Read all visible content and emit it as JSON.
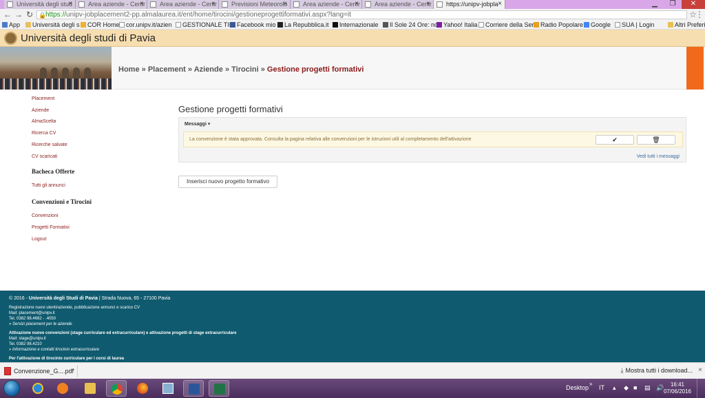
{
  "browser": {
    "tabs": [
      {
        "label": "Università degli stud"
      },
      {
        "label": "Area aziende - Centr"
      },
      {
        "label": "Area aziende - Centr"
      },
      {
        "label": "Previsioni Meteorolo"
      },
      {
        "label": "Area aziende - Centr"
      },
      {
        "label": "Area aziende - Centr"
      },
      {
        "label": "https://unipv-jobpla"
      }
    ],
    "url_scheme": "https://",
    "url_rest": "unipv-jobplacement2-pp.almalaurea.it/ent/home/tirocini/gestioneprogettiformativi.aspx?lang=it",
    "bookmarks": [
      "App",
      "Università degli s",
      "COR Home",
      "cor.unipv.it/azien",
      "GESTIONALE TIR",
      "Facebook mio",
      "La Repubblica.it",
      "Internazionale",
      "Il Sole 24 Ore: no",
      "Yahoo! Italia",
      "Corriere della Ser",
      "Radio Popolare",
      "Google",
      "SUA | Login",
      "Altri Preferiti"
    ]
  },
  "site": {
    "title": "Università degli studi di Pavia",
    "accent": "#8b1a1a",
    "orange": "#f16a1c"
  },
  "breadcrumb": {
    "home": "Home",
    "placement": "Placement",
    "aziende": "Aziende",
    "tirocini": "Tirocini",
    "current": "Gestione progetti formativi",
    "sep": "»"
  },
  "sidebar": {
    "links1": [
      "Placement",
      "Aziende",
      "AlmaScelta",
      "Ricerca CV",
      "Ricerche salvate",
      "CV scaricati"
    ],
    "heading_bacheca": "Bacheca Offerte",
    "links2": [
      "Tutti gli annunci"
    ],
    "heading_convenzioni": "Convenzioni e Tirocini",
    "links3": [
      "Convenzioni",
      "Progetti Formativi",
      "Logout"
    ]
  },
  "main": {
    "title": "Gestione progetti formativi",
    "messages_label": "Messaggi",
    "alert_text": "La convenzione è stata approvata. Consulta la pagina relativa alle convenzioni per le istruzioni utili al completamento dell'attivazione",
    "check_icon": "✔",
    "trash_icon": "🗑",
    "see_all": "Vedi tutti i messaggi",
    "new_button": "Inserisci nuovo progetto formativo"
  },
  "footer": {
    "copyright": "© 2016 - ",
    "uni": "Università degli Studi di Pavia",
    "address": " | Strada Nuova, 65 - 27100 Pavia",
    "b1_title": "Registrazione nuovi utenti/aziende, pubblicazione annunci e scarico CV",
    "b1_mail": "Mail: placement@unipv.it",
    "b1_tel": "Tel. 0382 98.4692 - .4050",
    "b1_link": "» Servizi placement per le aziende",
    "b2_title": "Attivazione nuove convenzioni (stage curriculare ed extracurriculare) e attivazione progetti di stage extracurriculare",
    "b2_mail": "Mail: stage@unipv.it",
    "b2_tel": "Tel. 0382 98.4210",
    "b2_link": "» Informazione e contatti tirocinio extracurriculare",
    "b3_title": "Per l'attivazione di tirocinio curriculare per i corsi di laurea"
  },
  "downloads": {
    "file": "Convenzione_G....pdf",
    "show_all": "Mostra tutti i download..."
  },
  "taskbar": {
    "desktop": "Desktop",
    "lang": "IT",
    "time": "16:41",
    "date": "07/06/2016"
  }
}
